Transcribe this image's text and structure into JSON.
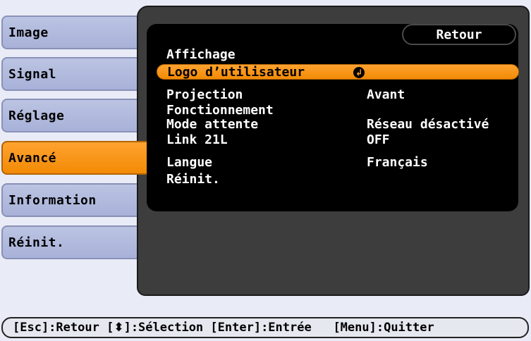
{
  "tabs": [
    {
      "label": "Image",
      "active": false
    },
    {
      "label": "Signal",
      "active": false
    },
    {
      "label": "Réglage",
      "active": false
    },
    {
      "label": "Avancé",
      "active": true
    },
    {
      "label": "Information",
      "active": false
    },
    {
      "label": "Réinit.",
      "active": false
    }
  ],
  "panel": {
    "retour_label": "Retour",
    "items": [
      {
        "label": "Affichage",
        "value": ""
      },
      {
        "label": "Logo d’utilisateur",
        "value": "",
        "icon": "enter-icon",
        "selected": true
      },
      {
        "label": "Projection",
        "value": "Avant"
      },
      {
        "label": "Fonctionnement",
        "value": ""
      },
      {
        "label": "Mode attente",
        "value": "Réseau désactivé"
      },
      {
        "label": "Link 21L",
        "value": "OFF"
      },
      {
        "label": "Langue",
        "value": "Français"
      },
      {
        "label": "Réinit.",
        "value": ""
      }
    ]
  },
  "helpbar": {
    "esc": "[Esc]:Retour",
    "select_prefix": "[",
    "select_suffix": "]:Sélection",
    "enter": "[Enter]:Entrée",
    "menu": "[Menu]:Quitter"
  },
  "colors": {
    "accent": "#f28a05",
    "tab_bg": "#a8b1d8",
    "panel_bg": "#3d3d3d",
    "list_bg": "#000000",
    "page_bg": "#e9ecf6"
  }
}
